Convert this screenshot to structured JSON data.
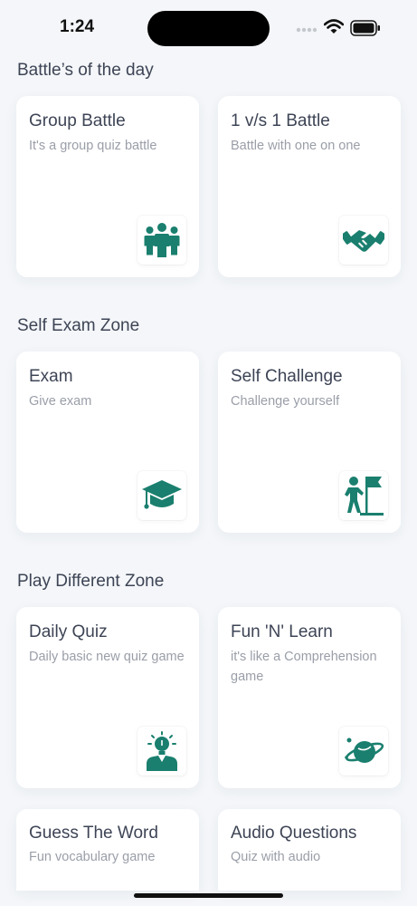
{
  "status": {
    "time": "1:24"
  },
  "sections": [
    {
      "title": "Battle’s of the day"
    },
    {
      "title": "Self Exam Zone"
    },
    {
      "title": "Play Different Zone"
    }
  ],
  "cards": {
    "group_battle": {
      "title": "Group Battle",
      "subtitle": "It's a group quiz battle",
      "icon": "group-people-icon"
    },
    "one_vs_one": {
      "title": "1 v/s 1 Battle",
      "subtitle": "Battle with one on one",
      "icon": "handshake-icon"
    },
    "exam": {
      "title": "Exam",
      "subtitle": "Give exam",
      "icon": "graduation-cap-icon"
    },
    "self_challenge": {
      "title": "Self Challenge",
      "subtitle": "Challenge yourself",
      "icon": "flag-person-icon"
    },
    "daily_quiz": {
      "title": "Daily Quiz",
      "subtitle": "Daily basic new quiz game",
      "icon": "idea-person-icon"
    },
    "fun_n_learn": {
      "title": "Fun 'N' Learn",
      "subtitle": "it's like a Comprehension game",
      "icon": "planet-icon"
    },
    "guess_word": {
      "title": "Guess The Word",
      "subtitle": "Fun vocabulary game"
    },
    "audio_questions": {
      "title": "Audio Questions",
      "subtitle": "Quiz with audio"
    }
  },
  "colors": {
    "accent": "#1a7f6e",
    "background": "#f4f6f9",
    "card": "#ffffff",
    "title": "#3d4455",
    "subtitle": "#9a9ea8"
  }
}
